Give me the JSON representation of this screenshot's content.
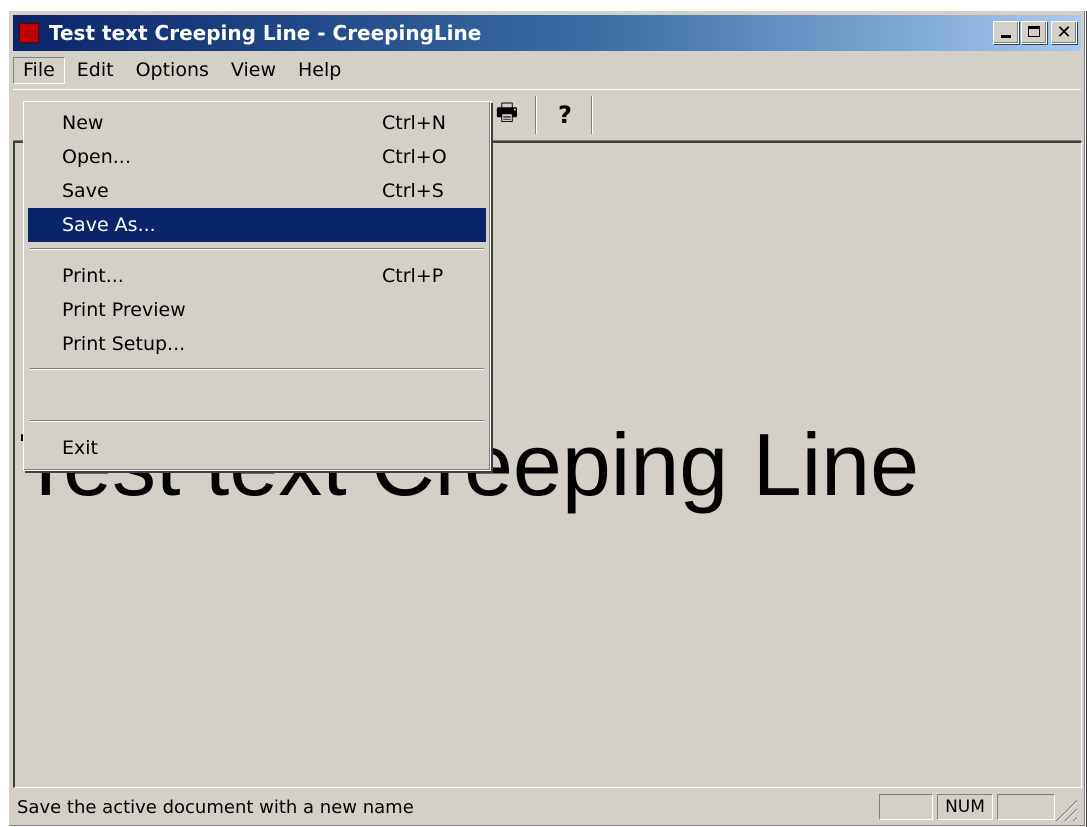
{
  "window": {
    "title": "Test text Creeping Line - CreepingLine"
  },
  "menubar": {
    "items": [
      {
        "label": "File"
      },
      {
        "label": "Edit"
      },
      {
        "label": "Options"
      },
      {
        "label": "View"
      },
      {
        "label": "Help"
      }
    ]
  },
  "toolbar": {
    "print_glyph": "🖶",
    "help_glyph": "?"
  },
  "file_menu": {
    "items": [
      {
        "label": "New",
        "accel": "Ctrl+N"
      },
      {
        "label": "Open...",
        "accel": "Ctrl+O"
      },
      {
        "label": "Save",
        "accel": "Ctrl+S"
      },
      {
        "label": "Save As...",
        "accel": ""
      },
      {
        "label": "Print...",
        "accel": "Ctrl+P"
      },
      {
        "label": "Print Preview",
        "accel": ""
      },
      {
        "label": "Print Setup...",
        "accel": ""
      },
      {
        "label": "Exit",
        "accel": ""
      }
    ],
    "highlighted": "Save As..."
  },
  "document": {
    "creeping_text": "Test text Creeping Line"
  },
  "statusbar": {
    "message": "Save the active document with a new name",
    "num_indicator": "NUM"
  },
  "colors": {
    "title_bar": "#0a246a",
    "highlight": "#0a246a",
    "face": "#d4d0c8"
  }
}
